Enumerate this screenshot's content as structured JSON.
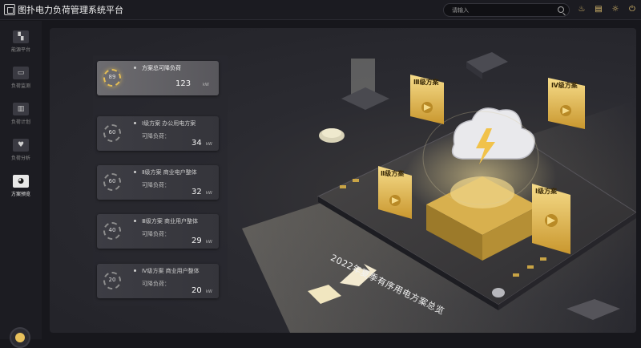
{
  "app": {
    "title": "图扑电力负荷管理系统平台",
    "search_placeholder": "请输入"
  },
  "toolbar": {
    "icons": [
      "bell-icon",
      "calendar-icon",
      "bulb-icon",
      "power-icon"
    ]
  },
  "sidebar": {
    "items": [
      {
        "label": "能源平台",
        "icon": "map-icon",
        "active": false
      },
      {
        "label": "负荷监测",
        "icon": "monitor-icon",
        "active": false
      },
      {
        "label": "负荷计划",
        "icon": "chart-icon",
        "active": false
      },
      {
        "label": "负荷分析",
        "icon": "heart-icon",
        "active": false
      },
      {
        "label": "方案预览",
        "icon": "pie-icon",
        "active": true
      }
    ]
  },
  "plans": [
    {
      "gauge": "89",
      "title": "方案总可降负荷",
      "subtitle": "",
      "value": "123",
      "unit": "kW",
      "highlight": true
    },
    {
      "gauge": "60",
      "title": "Ⅰ级方案  办公用电方案",
      "subtitle": "可降负荷：",
      "value": "34",
      "unit": "kW",
      "highlight": false
    },
    {
      "gauge": "60",
      "title": "Ⅱ级方案  商业电户整体",
      "subtitle": "可降负荷：",
      "value": "32",
      "unit": "kW",
      "highlight": false
    },
    {
      "gauge": "40",
      "title": "Ⅲ级方案  商业用户整体",
      "subtitle": "可降负荷：",
      "value": "29",
      "unit": "kW",
      "highlight": false
    },
    {
      "gauge": "20",
      "title": "Ⅳ级方案  商业用户整体",
      "subtitle": "可降负荷：",
      "value": "20",
      "unit": "kW",
      "highlight": false
    }
  ],
  "scene": {
    "caption": "2022年夏季有序用电方案总览",
    "labels": [
      "Ⅲ级方案",
      "Ⅳ级方案",
      "Ⅱ级方案",
      "Ⅰ级方案"
    ],
    "accent": "#e8c15c"
  }
}
